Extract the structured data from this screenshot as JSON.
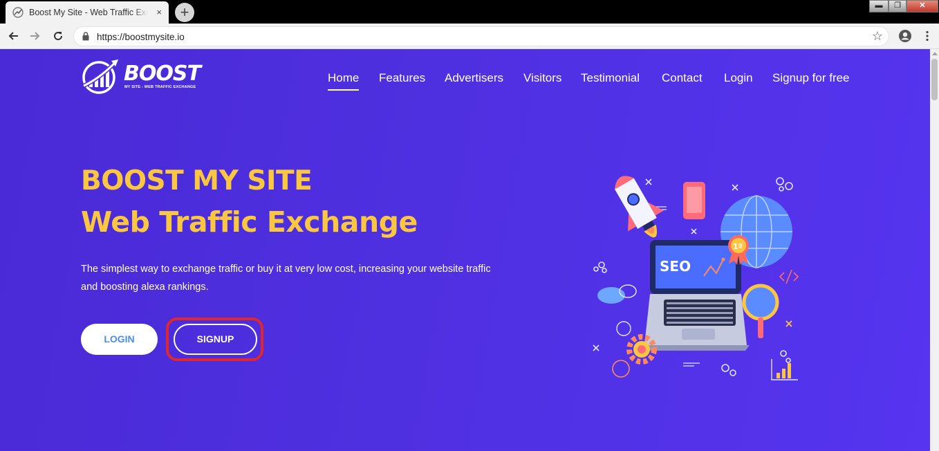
{
  "browser": {
    "tab_title": "Boost My Site - Web Traffic Exchange",
    "tab_close": "×",
    "new_tab": "+",
    "url": "https://boostmysite.io",
    "window_controls": {
      "minimize": "▬",
      "maximize": "❐",
      "close": "✕"
    }
  },
  "site": {
    "logo": {
      "text": "BOOST",
      "subtitle": "MY SITE - WEB TRAFFIC EXCHANGE"
    },
    "nav": [
      "Home",
      "Features",
      "Advertisers",
      "Visitors",
      "Testimonial",
      "Contact",
      "Login",
      "Signup for free"
    ],
    "active_nav": "Home",
    "hero": {
      "title_line1": "BOOST MY SITE",
      "title_line2": "Web Traffic Exchange",
      "description": "The simplest way to exchange traffic or buy it at very low cost, increasing your website traffic and boosting alexa rankings.",
      "login_button": "LOGIN",
      "signup_button": "SIGNUP"
    },
    "illustration": {
      "seo_label": "SEO",
      "badge": "1º"
    }
  },
  "colors": {
    "page_bg": "#4f30e0",
    "hero_title": "#fbc740",
    "login_text": "#4a8cf0",
    "highlight_outline": "#e0262e"
  }
}
